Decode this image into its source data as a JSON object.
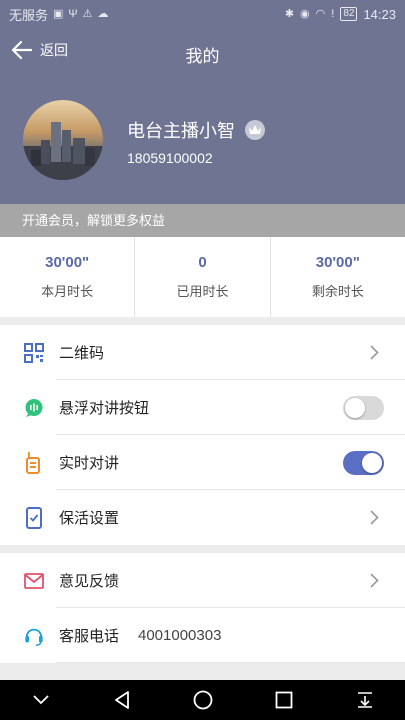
{
  "status_bar": {
    "carrier": "无服务",
    "battery": "82",
    "time": "14:23"
  },
  "nav": {
    "back_label": "返回",
    "title": "我的"
  },
  "profile": {
    "name": "电台主播小智",
    "phone": "18059100002"
  },
  "vip_banner": "开通会员，解锁更多权益",
  "stats": [
    {
      "value": "30'00\"",
      "label": "本月时长"
    },
    {
      "value": "0",
      "label": "已用时长"
    },
    {
      "value": "30'00\"",
      "label": "剩余时长"
    }
  ],
  "settings": {
    "qr_code": "二维码",
    "float_button": "悬浮对讲按钮",
    "float_button_on": false,
    "realtime_talk": "实时对讲",
    "realtime_talk_on": true,
    "keep_alive": "保活设置"
  },
  "support": {
    "feedback": "意见反馈",
    "service_phone_label": "客服电话",
    "service_phone": "4001000303"
  },
  "colors": {
    "header_bg": "#6f7493",
    "accent": "#5a6fc3",
    "stat_value": "#5a6aa6"
  }
}
